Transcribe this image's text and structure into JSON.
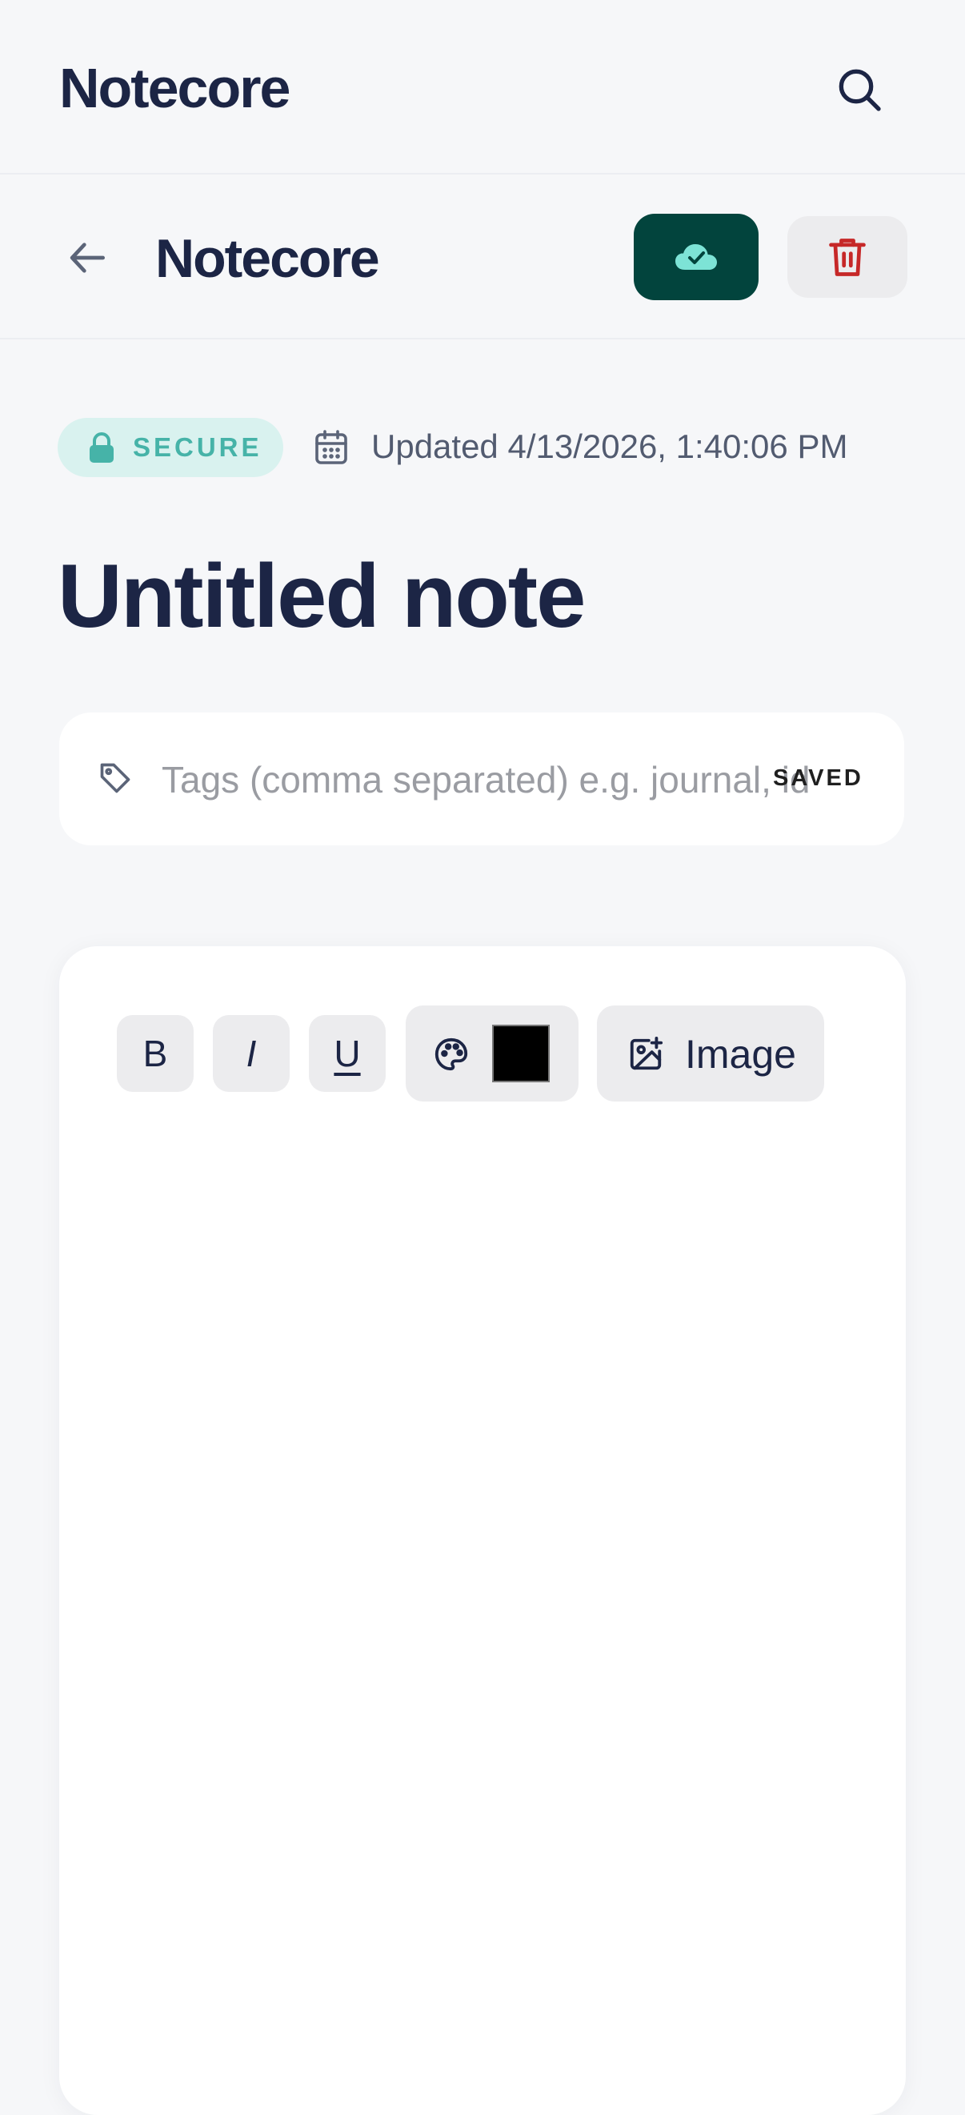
{
  "app": {
    "name": "Notecore"
  },
  "note_bar": {
    "title": "Notecore"
  },
  "meta": {
    "badge": "SECURE",
    "updated": "Updated 4/13/2026, 1:40:06 PM"
  },
  "note": {
    "title": "Untitled note"
  },
  "tags": {
    "value": "",
    "placeholder": "Tags (comma separated) e.g. journal, ideas",
    "status": "SAVED"
  },
  "toolbar": {
    "bold": "B",
    "italic": "I",
    "underline": "U",
    "current_color": "#000000",
    "image_label": "Image"
  },
  "colors": {
    "accent": "#02443d",
    "accent_light": "#d9f2ef",
    "badge_text": "#46b3a8",
    "danger": "#c62828",
    "ink": "#1c2545"
  },
  "icons": {
    "search": "search-icon",
    "back": "arrow-left-icon",
    "sync": "cloud-check-icon",
    "delete": "trash-icon",
    "lock": "lock-icon",
    "calendar": "calendar-icon",
    "tag": "tag-icon",
    "palette": "palette-icon",
    "image": "image-plus-icon"
  }
}
